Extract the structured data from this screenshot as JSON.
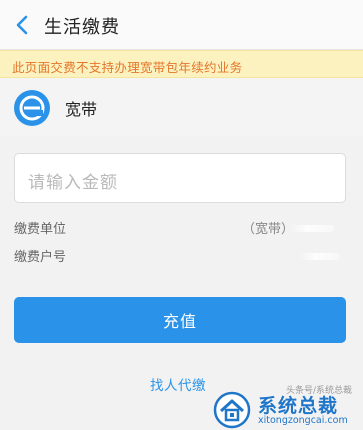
{
  "header": {
    "title": "生活缴费",
    "back_icon": "chevron-left-icon"
  },
  "notice": {
    "text": "此页面交费不支持办理宽带包年续约业务"
  },
  "service": {
    "name": "宽带",
    "icon": "broadband-e-icon"
  },
  "amount_input": {
    "placeholder": "请输入金额",
    "value": ""
  },
  "payment_info": {
    "unit_label": "缴费单位",
    "unit_value": "（宽带）",
    "account_label": "缴费户号"
  },
  "recharge_button": {
    "label": "充值"
  },
  "find_payer_link": {
    "label": "找人代缴"
  },
  "watermark": {
    "small_text": "头条号/系统总裁",
    "main_text": "系统总裁",
    "site_text": "xitongzongcai.com"
  },
  "colors": {
    "accent": "#2a93e9",
    "notice_bg": "#fcf2bf",
    "notice_text": "#e4762a"
  }
}
